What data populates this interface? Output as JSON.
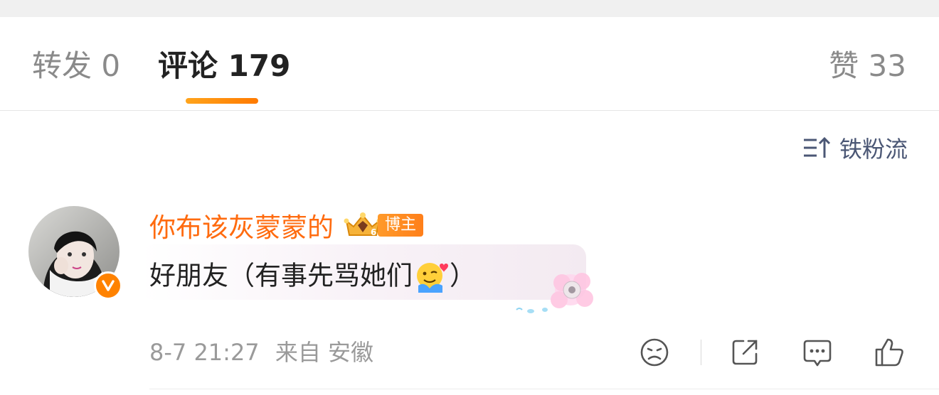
{
  "tabs": {
    "repost": "转发 0",
    "comments": "评论 179",
    "likes": "赞 33"
  },
  "sort": {
    "label": "铁粉流",
    "icon": "sort-up-icon"
  },
  "comment": {
    "username": "你布该灰蒙蒙的",
    "role_tag": "博主",
    "verified_badge": "V",
    "text": "好朋友（有事先骂她们",
    "text_close": "）",
    "emoji": "hug-face-emoji",
    "time": "8-7 21:27",
    "source": "来自 安徽",
    "actions": [
      "dislike-icon",
      "share-icon",
      "comment-icon",
      "like-icon"
    ]
  },
  "colors": {
    "accent": "#ff7a00",
    "username": "#ff6b0f",
    "muted": "#9a9a9a",
    "sort_text": "#4b5775"
  }
}
